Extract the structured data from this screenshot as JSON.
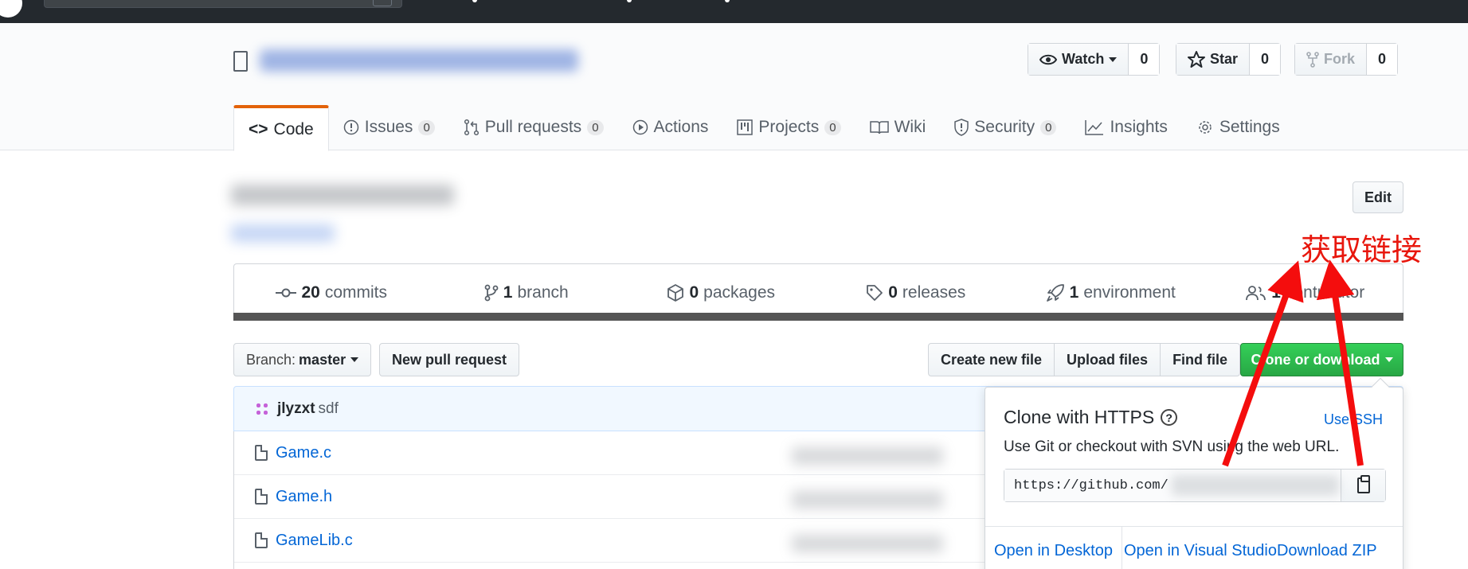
{
  "repo_head": {
    "watch": {
      "label": "Watch",
      "count": "0"
    },
    "star": {
      "label": "Star",
      "count": "0"
    },
    "fork": {
      "label": "Fork",
      "count": "0"
    }
  },
  "tabs": [
    {
      "label": "Code",
      "icon": "code-icon"
    },
    {
      "label": "Issues",
      "count": "0",
      "icon": "issue-icon"
    },
    {
      "label": "Pull requests",
      "count": "0",
      "icon": "pull-request-icon"
    },
    {
      "label": "Actions",
      "icon": "play-icon"
    },
    {
      "label": "Projects",
      "count": "0",
      "icon": "project-icon"
    },
    {
      "label": "Wiki",
      "icon": "book-icon"
    },
    {
      "label": "Security",
      "count": "0",
      "icon": "shield-icon"
    },
    {
      "label": "Insights",
      "icon": "graph-icon"
    },
    {
      "label": "Settings",
      "icon": "gear-icon"
    }
  ],
  "edit_label": "Edit",
  "annotation": "获取链接",
  "numbers": [
    {
      "value": "20",
      "label": "commits"
    },
    {
      "value": "1",
      "label": "branch"
    },
    {
      "value": "0",
      "label": "packages"
    },
    {
      "value": "0",
      "label": "releases"
    },
    {
      "value": "1",
      "label": "environment"
    },
    {
      "value": "1",
      "label": "contributor"
    }
  ],
  "toolbar": {
    "branch_prefix": "Branch:",
    "branch_name": "master",
    "new_pr": "New pull request",
    "create_file": "Create new file",
    "upload_files": "Upload files",
    "find_file": "Find file",
    "clone_download": "Clone or download"
  },
  "commit": {
    "author": "jlyzxt",
    "message": "sdf"
  },
  "files": [
    {
      "name": "Game.c"
    },
    {
      "name": "Game.h"
    },
    {
      "name": "GameLib.c"
    }
  ],
  "clone": {
    "title": "Clone with HTTPS",
    "use_ssh": "Use SSH",
    "subtitle": "Use Git or checkout with SVN using the web URL.",
    "url": "https://github.com/",
    "open_desktop": "Open in Desktop",
    "open_vs": "Open in Visual Studio",
    "download_zip": "Download ZIP"
  },
  "colors": {
    "accent_green": "#28a745",
    "link": "#0366d6",
    "annotation": "#e8170d",
    "tab_underline": "#e36209"
  }
}
